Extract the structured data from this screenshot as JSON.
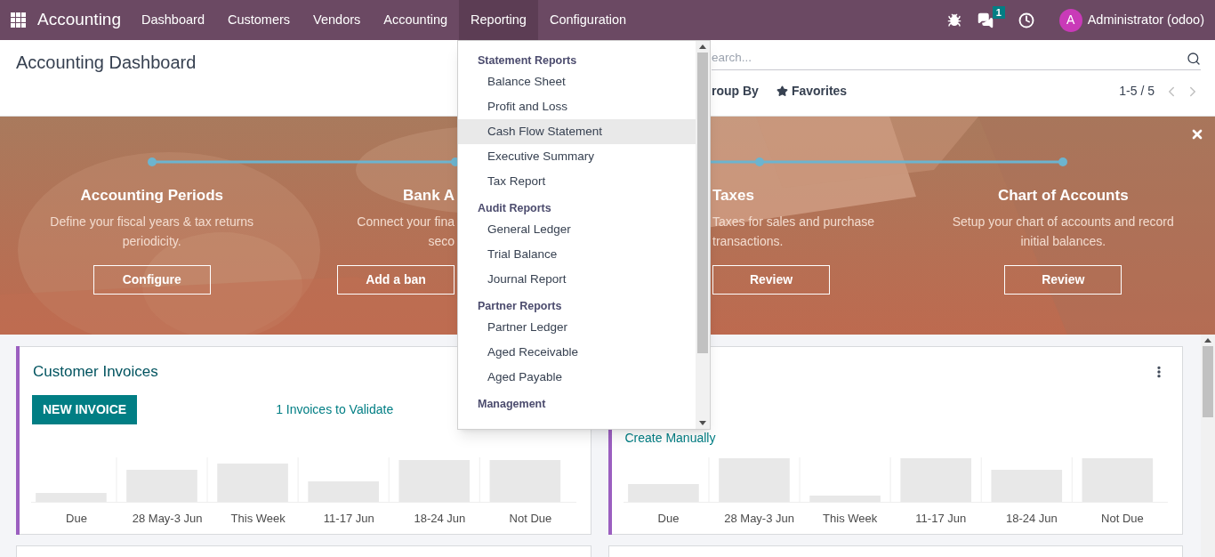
{
  "navbar": {
    "app_name": "Accounting",
    "menu": [
      {
        "label": "Dashboard",
        "selected": false
      },
      {
        "label": "Customers",
        "selected": false
      },
      {
        "label": "Vendors",
        "selected": false
      },
      {
        "label": "Accounting",
        "selected": false
      },
      {
        "label": "Reporting",
        "selected": true
      },
      {
        "label": "Configuration",
        "selected": false
      }
    ],
    "message_count": "1",
    "avatar_letter": "A",
    "user": "Administrator (odoo)"
  },
  "control_panel": {
    "title": "Accounting Dashboard",
    "search": {
      "placeholder": "earch..."
    },
    "group_by": "roup By",
    "favorites": "Favorites",
    "pager": "1-5 / 5"
  },
  "banner": {
    "steps": [
      {
        "title": "Accounting Periods",
        "desc_lines": [
          "Define your fiscal years & tax returns",
          "periodicity."
        ],
        "button": "Configure"
      },
      {
        "title": "Bank A",
        "desc_lines": [
          "Connect your fina",
          "seco"
        ],
        "button": "Add a ban"
      },
      {
        "title": "Taxes",
        "desc_lines": [
          "Taxes for sales and purchase",
          "transactions."
        ],
        "button": "Review"
      },
      {
        "title": "Chart of Accounts",
        "desc_lines": [
          "Setup your chart of accounts and record",
          "initial balances."
        ],
        "button": "Review"
      }
    ]
  },
  "reporting_menu": {
    "sections": [
      {
        "header": "Statement Reports",
        "items": [
          {
            "label": "Balance Sheet",
            "selected": false
          },
          {
            "label": "Profit and Loss",
            "selected": false
          },
          {
            "label": "Cash Flow Statement",
            "selected": true
          },
          {
            "label": "Executive Summary",
            "selected": false
          },
          {
            "label": "Tax Report",
            "selected": false
          }
        ]
      },
      {
        "header": "Audit Reports",
        "items": [
          {
            "label": "General Ledger",
            "selected": false
          },
          {
            "label": "Trial Balance",
            "selected": false
          },
          {
            "label": "Journal Report",
            "selected": false
          }
        ]
      },
      {
        "header": "Partner Reports",
        "items": [
          {
            "label": "Partner Ledger",
            "selected": false
          },
          {
            "label": "Aged Receivable",
            "selected": false
          },
          {
            "label": "Aged Payable",
            "selected": false
          }
        ]
      },
      {
        "header": "Management"
      }
    ]
  },
  "cards": [
    {
      "title": "Customer Invoices",
      "button": "NEW INVOICE",
      "link": "1 Invoices to Validate",
      "chart_labels": [
        "Due",
        "28 May-3 Jun",
        "This Week",
        "11-17 Jun",
        "18-24 Jun",
        "Not Due"
      ]
    },
    {
      "link": "Create Manually",
      "chart_labels": [
        "Due",
        "28 May-3 Jun",
        "This Week",
        "11-17 Jun",
        "18-24 Jun",
        "Not Due"
      ]
    }
  ]
}
